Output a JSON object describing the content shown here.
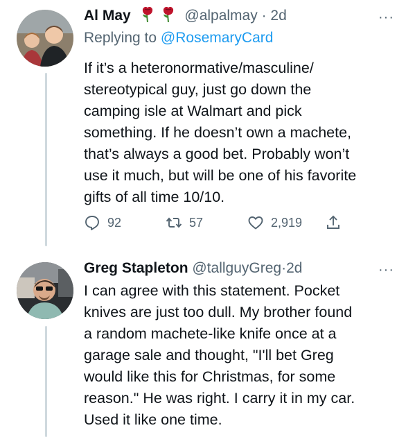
{
  "tweet1": {
    "name": "Al May",
    "handle": "@alpalmay",
    "separator": "·",
    "time": "2d",
    "reply_prefix": "Replying to ",
    "reply_handle": "@RosemaryCard",
    "more_label": "···",
    "lines": [
      "If it’s a heteronormative/masculine/",
      "stereotypical guy, just go down the",
      "camping isle at Walmart and pick",
      "something. If he doesn’t own a machete,",
      "that’s always a good bet. Probably won’t",
      "use it much, but will be one of his favorite",
      "gifts of all time 10/10."
    ],
    "stats": {
      "replies": "92",
      "retweets": "57",
      "likes": "2,919"
    },
    "icons": [
      "rose-icon",
      "reply-icon",
      "retweet-icon",
      "like-icon",
      "share-icon"
    ]
  },
  "tweet2": {
    "name": "Greg Stapleton",
    "handle": "@tallguyGreg",
    "separator": "·",
    "time": "2d",
    "more_label": "···",
    "lines": [
      "I can agree with this statement. Pocket",
      "knives are just too dull. My brother found",
      "a random machete-like knife once at a",
      "garage sale and thought, \"I'll bet Greg",
      "would like this for Christmas, for some",
      "reason.\" He was right. I carry it in my car.",
      "Used it like one time."
    ]
  },
  "colors": {
    "text": "#0f1419",
    "secondary": "#536471",
    "link": "#1d9bf0",
    "thread_line": "#cfd9de",
    "rose": "#c0142c"
  }
}
